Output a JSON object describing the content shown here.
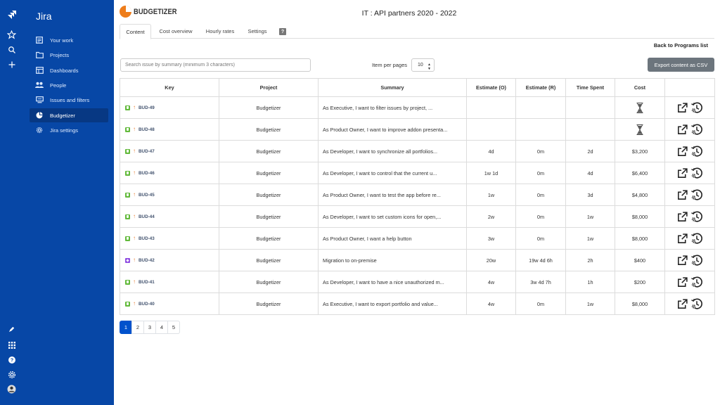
{
  "sidebar": {
    "brand": "Jira",
    "items": [
      {
        "label": "Your work",
        "icon": "your-work-icon"
      },
      {
        "label": "Projects",
        "icon": "folder-icon"
      },
      {
        "label": "Dashboards",
        "icon": "dashboard-icon"
      },
      {
        "label": "People",
        "icon": "people-icon"
      },
      {
        "label": "Issues and filters",
        "icon": "issues-icon"
      },
      {
        "label": "Budgetizer",
        "icon": "pie-chart-icon",
        "active": true
      },
      {
        "label": "Jira settings",
        "icon": "gear-icon"
      }
    ]
  },
  "app": {
    "logo_text": "BUDGETIZER",
    "title": "IT : API partners 2020 - 2022"
  },
  "tabs": [
    "Content",
    "Cost overview",
    "Hourly rates",
    "Settings"
  ],
  "help_label": "?",
  "back_link": "Back to Programs list",
  "search": {
    "placeholder": "Search issue by summary (minimum 3 characters)",
    "value": ""
  },
  "per_page": {
    "label": "Item per pages",
    "value": "10"
  },
  "export_label": "Export content as CSV",
  "table": {
    "headers": [
      "Key",
      "Project",
      "Summary",
      "Estimate (O)",
      "Estimate (R)",
      "Time Spent",
      "Cost",
      ""
    ],
    "rows": [
      {
        "key": "BUD-49",
        "type": "story",
        "project": "Budgetizer",
        "summary": "As Executive, I want to filter issues by project, ...",
        "est_o": "",
        "est_r": "",
        "spent": "",
        "cost": "",
        "cost_hourglass": true
      },
      {
        "key": "BUD-48",
        "type": "story",
        "project": "Budgetizer",
        "summary": "As Product Owner, I want to improve addon presenta...",
        "est_o": "",
        "est_r": "",
        "spent": "",
        "cost": "",
        "cost_hourglass": true
      },
      {
        "key": "BUD-47",
        "type": "story",
        "project": "Budgetizer",
        "summary": "As Developer, I want to synchronize all portfolios...",
        "est_o": "4d",
        "est_r": "0m",
        "spent": "2d",
        "cost": "$3,200"
      },
      {
        "key": "BUD-46",
        "type": "story",
        "project": "Budgetizer",
        "summary": "As Developer, I want to control that the current u...",
        "est_o": "1w 1d",
        "est_r": "0m",
        "spent": "4d",
        "cost": "$6,400"
      },
      {
        "key": "BUD-45",
        "type": "story",
        "project": "Budgetizer",
        "summary": "As Product Owner, I want to test the app before re...",
        "est_o": "1w",
        "est_r": "0m",
        "spent": "3d",
        "cost": "$4,800"
      },
      {
        "key": "BUD-44",
        "type": "story",
        "project": "Budgetizer",
        "summary": "As Developer, I want to set custom icons for open,...",
        "est_o": "2w",
        "est_r": "0m",
        "spent": "1w",
        "cost": "$8,000"
      },
      {
        "key": "BUD-43",
        "type": "story",
        "project": "Budgetizer",
        "summary": "As Product Owner, I want a help button",
        "est_o": "3w",
        "est_r": "0m",
        "spent": "1w",
        "cost": "$8,000"
      },
      {
        "key": "BUD-42",
        "type": "epic",
        "project": "Budgetizer",
        "summary": "Migration to on-premise",
        "est_o": "20w",
        "est_r": "19w 4d 6h",
        "spent": "2h",
        "cost": "$400"
      },
      {
        "key": "BUD-41",
        "type": "story",
        "project": "Budgetizer",
        "summary": "As Developer, I want to have a nice unauthorized m...",
        "est_o": "4w",
        "est_r": "3w 4d 7h",
        "spent": "1h",
        "cost": "$200"
      },
      {
        "key": "BUD-40",
        "type": "story",
        "project": "Budgetizer",
        "summary": "As Executive, I want to export portfolio and value...",
        "est_o": "4w",
        "est_r": "0m",
        "spent": "1w",
        "cost": "$8,000"
      }
    ]
  },
  "pagination": {
    "pages": [
      "1",
      "2",
      "3",
      "4",
      "5"
    ],
    "current": "1"
  },
  "colors": {
    "sidebar": "#0747a6",
    "accent": "#0052cc",
    "logo": "#ee7d1b",
    "export_button": "#6c757d",
    "story": "#63ba3c",
    "epic": "#904ee2",
    "priority": "#e97f33"
  }
}
